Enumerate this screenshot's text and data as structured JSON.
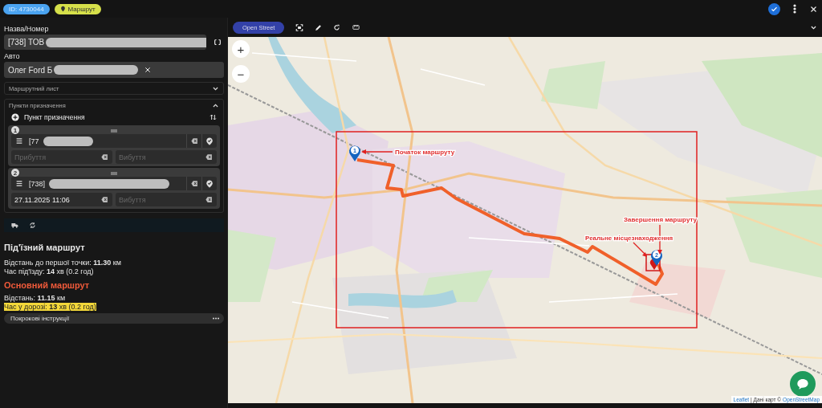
{
  "header": {
    "id_badge": "ID: 4730044",
    "route_badge": "Маршрут"
  },
  "form": {
    "name_label": "Назва/Номер",
    "name_value": "[738] ТОВ",
    "auto_label": "Авто",
    "auto_value": "Олег Ford Б",
    "waybill": {
      "label": "Маршрутний лист",
      "expanded": false
    },
    "destinations": {
      "label": "Пункти призначення",
      "expanded": true,
      "add_label": "Пункт призначення",
      "points": [
        {
          "number": "1",
          "value": "[77",
          "arrival": {
            "placeholder": "Прибуття"
          },
          "departure": {
            "placeholder": "Вибуття"
          }
        },
        {
          "number": "2",
          "value": "[738]",
          "arrival": {
            "value": "27.11.2025 11:06"
          },
          "departure": {
            "placeholder": "Вибуття"
          }
        }
      ]
    }
  },
  "approach_route": {
    "title": "Під'їзний маршрут",
    "lines": [
      "Відстань до першої точки: **11.30** км",
      "Час під'їзду: **14** хв (0.2 год)"
    ]
  },
  "main_route": {
    "title": "Основний маршрут",
    "lines": [
      {
        "text": "Відстань: **11.15** км",
        "highlighted": false
      },
      {
        "text": "Час у дорозі: **13** хв (0.2 год)",
        "highlighted": true
      }
    ]
  },
  "instructions": {
    "label": "Покрокові інструкції"
  },
  "map": {
    "layer_button": "Open Street",
    "zoom_in": "+",
    "zoom_out": "−",
    "markers": [
      {
        "number": "1"
      },
      {
        "number": "2"
      }
    ],
    "annotations": [
      {
        "kind": "start",
        "text": "Початок маршруту"
      },
      {
        "kind": "end",
        "text": "Завершення маршруту"
      },
      {
        "kind": "actual",
        "text": "Реальне місцезнаходження"
      }
    ],
    "attribution": {
      "leaflet": "Leaflet",
      "text": "| Дані карт ©",
      "osm": "OpenStreetMap"
    }
  }
}
